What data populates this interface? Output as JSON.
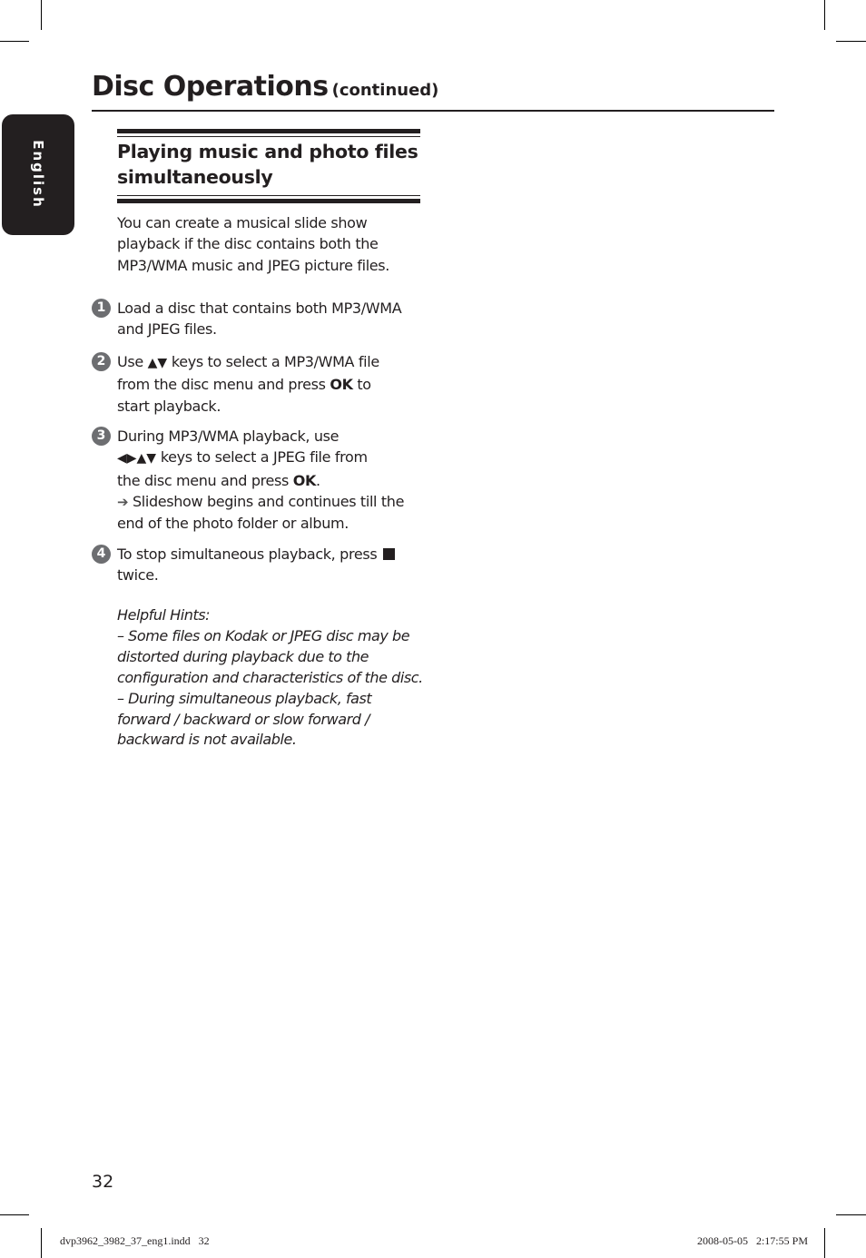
{
  "language_tab": "English",
  "header": {
    "title": "Disc Operations",
    "continued": "(continued)"
  },
  "section": {
    "heading_lines": [
      "Playing music and photo files",
      "simultaneously"
    ],
    "intro_lines": [
      "You can create a musical slide show",
      "playback if the disc contains both the",
      "MP3/WMA music and JPEG picture files."
    ]
  },
  "steps": [
    {
      "number": "1",
      "lines": [
        "Load a disc that contains both MP3/WMA",
        "and JPEG files."
      ]
    },
    {
      "number": "2",
      "keys": "▲▼",
      "line1_suffix": " keys to select a MP3/WMA file",
      "line1_prefix": "Use ",
      "line2_prefix": "from the disc menu and press ",
      "line2_bold": "OK",
      "line2_suffix": " to",
      "line3": "start playback."
    },
    {
      "number": "3",
      "line1": "During MP3/WMA playback, use",
      "keys": "◀▶▲▼",
      "line2_suffix": " keys to select a JPEG file from",
      "line3_prefix": "the disc menu and press ",
      "line3_bold": "OK",
      "line3_suffix": ".",
      "result_arrow": "➔",
      "result_line1": " Slideshow begins and continues till the",
      "result_line2": "end of the photo folder or album."
    },
    {
      "number": "4",
      "line1": "To stop simultaneous playback, press ",
      "stop_icon": "stop-icon",
      "line2": "twice."
    }
  ],
  "hints": {
    "title": "Helpful Hints:",
    "lines": [
      "–  Some files on Kodak or JPEG disc may be",
      "distorted during playback due to the",
      "configuration and characteristics of the disc.",
      "–  During simultaneous playback, fast",
      "forward / backward or slow forward /",
      "backward is not available."
    ]
  },
  "footer": {
    "page_number": "32",
    "slug_file": "dvp3962_3982_37_eng1.indd   32",
    "slug_date": "2008-05-05   2:17:55 PM"
  }
}
